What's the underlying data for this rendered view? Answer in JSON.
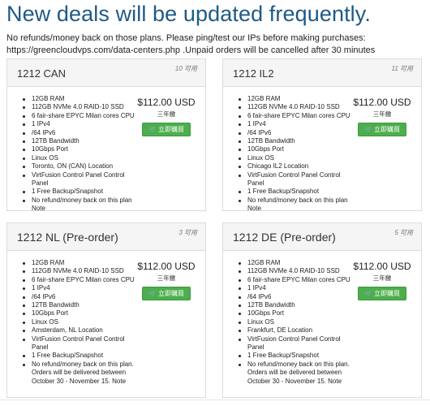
{
  "page": {
    "title": "New deals will be updated frequently.",
    "notice": "No refunds/money back on those plans. Please ping/test our IPs before making purchases: https://greencloudvps.com/data-centers.php .Unpaid orders will be cancelled after 30 minutes"
  },
  "cards": [
    {
      "title": "1212 CAN",
      "availability": "10 可用",
      "price": "$112.00 USD",
      "cycle": "三年繳",
      "buy_label": "立即購買",
      "features": [
        "12GB RAM",
        "112GB NVMe 4.0 RAID-10 SSD",
        "6 fair-share EPYC Milan cores CPU",
        "1 IPv4",
        "/64 IPv6",
        "12TB Bandwidth",
        "10Gbps Port",
        "Linux OS",
        "Toronto, ON (CAN) Location",
        "VirtFusion Control Panel Control Panel",
        "1 Free Backup/Snapshot",
        "No refund/money back on this plan Note"
      ]
    },
    {
      "title": "1212 IL2",
      "availability": "11 可用",
      "price": "$112.00 USD",
      "cycle": "三年繳",
      "buy_label": "立即購買",
      "features": [
        "12GB RAM",
        "112GB NVMe 4.0 RAID-10 SSD",
        "6 fair-share EPYC Milan cores CPU",
        "1 IPv4",
        "/64 IPv6",
        "12TB Bandwidth",
        "10Gbps Port",
        "Linux OS",
        "Chicago IL2 Location",
        "VirtFusion Control Panel Control Panel",
        "1 Free Backup/Snapshot",
        "No refund/money back on this plan Note"
      ]
    },
    {
      "title": "1212 NL (Pre-order)",
      "availability": "3 可用",
      "price": "$112.00 USD",
      "cycle": "三年繳",
      "buy_label": "立即購買",
      "features": [
        "12GB RAM",
        "112GB NVMe 4.0 RAID-10 SSD",
        "6 fair-share EPYC Milan cores CPU",
        "1 IPv4",
        "/64 IPv6",
        "12TB Bandwidth",
        "10Gbps Port",
        "Linux OS",
        "Amsterdam, NL Location",
        "VirtFusion Control Panel Control Panel",
        "1 Free Backup/Snapshot",
        "No refund/money back on this plan. Orders will be delivered between October 30 - November 15. Note"
      ]
    },
    {
      "title": "1212 DE (Pre-order)",
      "availability": "5 可用",
      "price": "$112.00 USD",
      "cycle": "三年繳",
      "buy_label": "立即購買",
      "features": [
        "12GB RAM",
        "112GB NVMe 4.0 RAID-10 SSD",
        "6 fair-share EPYC Milan cores CPU",
        "1 IPv4",
        "/64 IPv6",
        "12TB Bandwidth",
        "10Gbps Port",
        "Linux OS",
        "Frankfurt, DE Location",
        "VirtFusion Control Panel Control Panel",
        "1 Free Backup/Snapshot",
        "No refund/money back on this plan. Orders will be delivered between October 30 - November 15. Note"
      ]
    }
  ]
}
